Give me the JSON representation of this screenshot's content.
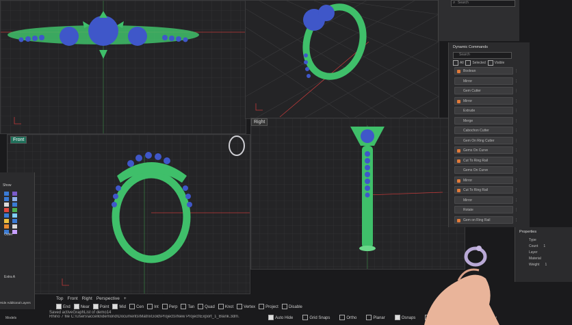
{
  "search": {
    "placeholder": "Search"
  },
  "dynamic_commands": {
    "title": "Dynamic Commands",
    "search_placeholder": "Search",
    "filters": [
      "All",
      "Selected",
      "Visible"
    ],
    "items": [
      {
        "label": "Boolean",
        "accent": true
      },
      {
        "label": "Mirror",
        "accent": false
      },
      {
        "label": "Gem Cutter",
        "accent": false
      },
      {
        "label": "Mirror",
        "accent": true
      },
      {
        "label": "Extrude",
        "accent": false
      },
      {
        "label": "Merge",
        "accent": false
      },
      {
        "label": "Cabochon Cutter",
        "accent": false
      },
      {
        "label": "Gem On Ring Cutter",
        "accent": false
      },
      {
        "label": "Gems On Curve",
        "accent": true
      },
      {
        "label": "Cut To Ring Rail",
        "accent": true
      },
      {
        "label": "Gems On Curve",
        "accent": false
      },
      {
        "label": "Mirror",
        "accent": true
      },
      {
        "label": "Cut To Ring Rail",
        "accent": true
      },
      {
        "label": "Mirror",
        "accent": false
      },
      {
        "label": "Rotate",
        "accent": false
      },
      {
        "label": "Gem on Ring Rail",
        "accent": true
      }
    ]
  },
  "properties": {
    "title": "Properties",
    "rows": [
      {
        "label": "Type",
        "value": ""
      },
      {
        "label": "Count",
        "value": "1"
      },
      {
        "label": "Layer",
        "value": ""
      },
      {
        "label": "Material",
        "value": ""
      },
      {
        "label": "Weight",
        "value": "1"
      }
    ]
  },
  "viewports": {
    "front_label": "Front",
    "right_label": "Right"
  },
  "layers": {
    "show_label": "Show",
    "items": [
      "Outer",
      "Extra A"
    ],
    "add_label": "Hide Additional Layers"
  },
  "view_tabs": [
    "Top",
    "Front",
    "Right",
    "Perspective",
    "+"
  ],
  "osnaps": [
    {
      "label": "End",
      "on": true
    },
    {
      "label": "Near",
      "on": true
    },
    {
      "label": "Point",
      "on": true
    },
    {
      "label": "Mid",
      "on": true
    },
    {
      "label": "Cen",
      "on": false
    },
    {
      "label": "Int",
      "on": false
    },
    {
      "label": "Perp",
      "on": false
    },
    {
      "label": "Tan",
      "on": false
    },
    {
      "label": "Quad",
      "on": false
    },
    {
      "label": "Knot",
      "on": false
    },
    {
      "label": "Vertex",
      "on": false
    },
    {
      "label": "Project",
      "on": false
    },
    {
      "label": "Disable",
      "on": false
    }
  ],
  "command_history": [
    "Saved activeGraphList of demo14",
    "Rhino 7 file C:\\Users\\accello\\demond\\Documents\\MatrixGold\\Projects\\New Project\\Export_1_Blank.3dm."
  ],
  "status_bar": [
    {
      "label": "Auto Hide",
      "on": true
    },
    {
      "label": "Grid Snaps",
      "on": false
    },
    {
      "label": "Ortho",
      "on": false
    },
    {
      "label": "Planar",
      "on": false
    },
    {
      "label": "Osnaps",
      "on": true
    },
    {
      "label": "SmartTrack",
      "on": false
    },
    {
      "label": "Record History",
      "on": false
    }
  ],
  "left_bottom_label": "Models",
  "colors": {
    "ring_green": "#3fbf6a",
    "gem_blue": "#3f57c9",
    "accent_orange": "#e07a3a",
    "active_tab": "#1f6f5a"
  }
}
